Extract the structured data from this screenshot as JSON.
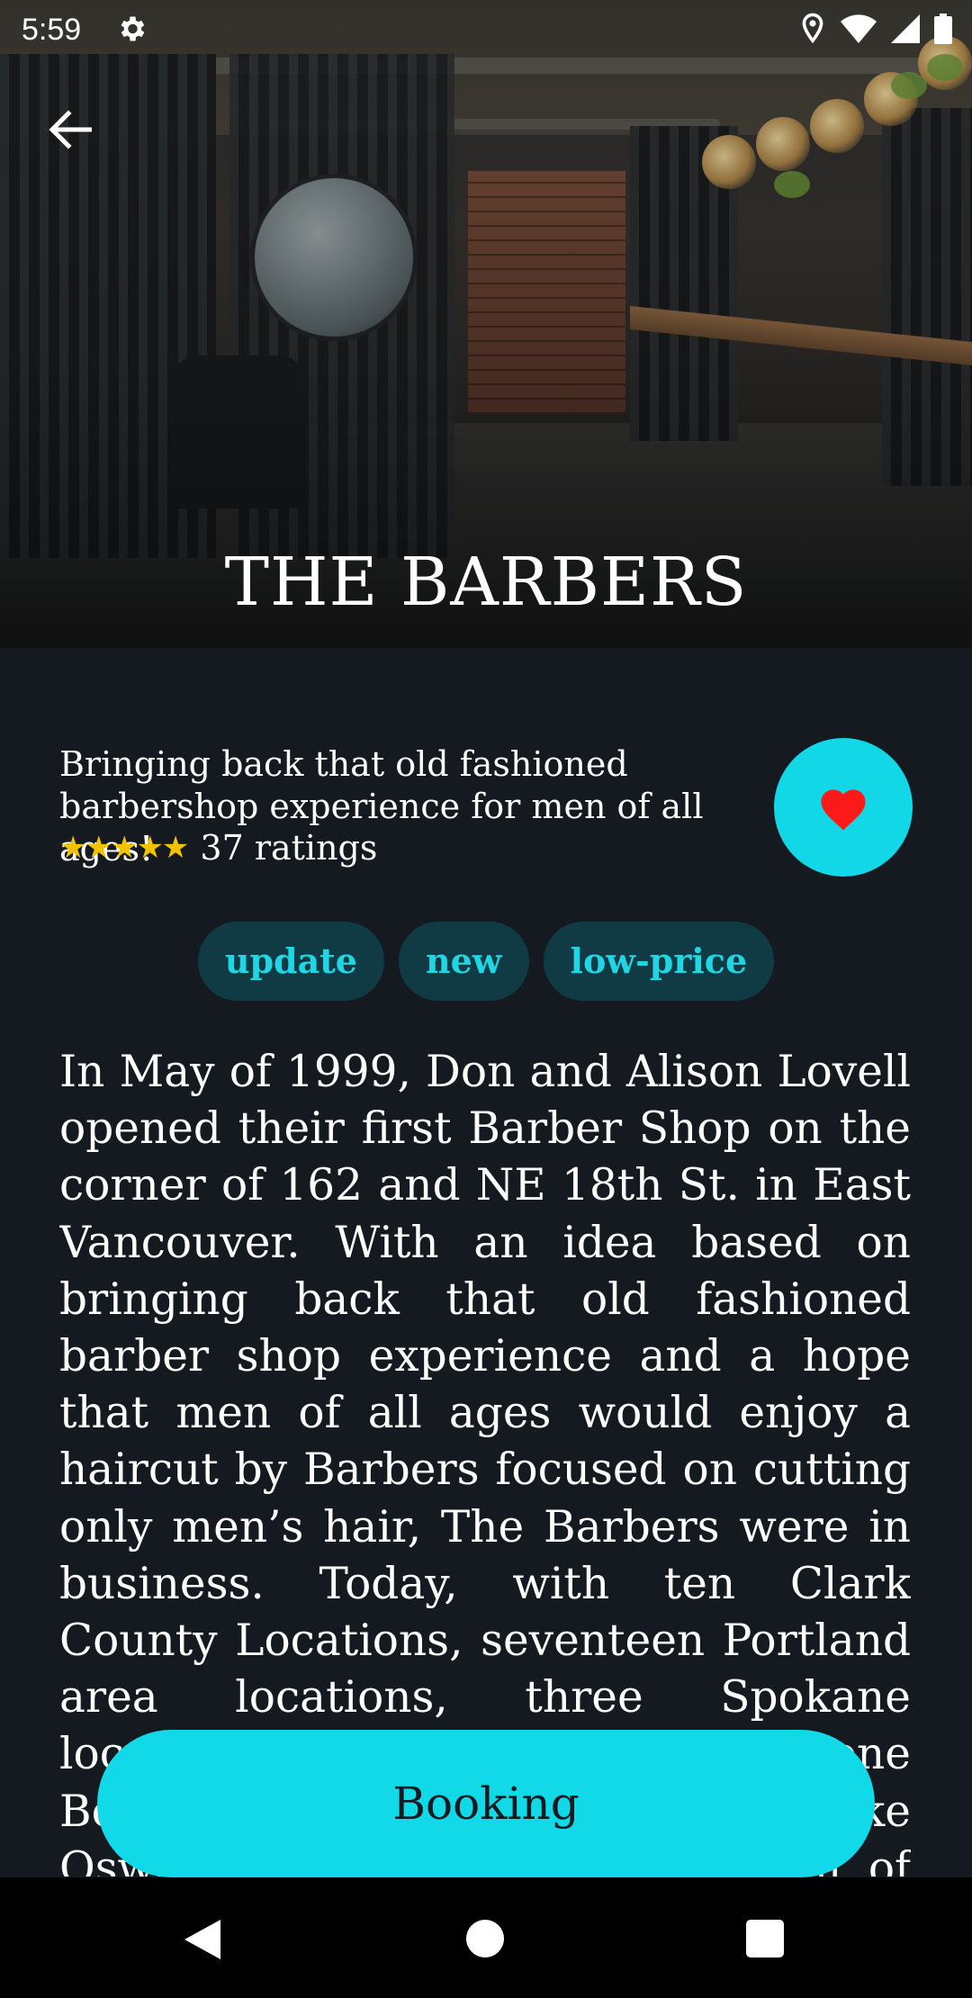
{
  "status_bar": {
    "time": "5:59",
    "icons": [
      "settings-icon",
      "location-icon",
      "wifi-icon",
      "signal-icon",
      "battery-icon"
    ]
  },
  "hero": {
    "title": "THE BARBERS",
    "image": "barbershop-interior-photo"
  },
  "shop": {
    "tagline": "Bringing back that old fashioned barbershop experience for men of all ages!",
    "stars": "★★★★★",
    "rating_value": 5,
    "ratings_count_text": "37 ratings",
    "favorite": true
  },
  "tags": [
    "update",
    "new",
    "low-price"
  ],
  "description": "In May of 1999, Don and Alison Lovell opened their first Barber Shop on the corner of 162 and NE 18th St. in East Vancouver. With an idea based on bringing back that old fashioned barber shop experience and a hope that men of all ages would enjoy a haircut by Barbers focused on cutting only men’s hair, The Barbers were in business. Today, with ten Clark County Locations, seventeen Portland area locations, three Spokane locations, one Corvallis location, one Bend location, one location in Lake Oswego and a growing the team of barbers and stylists a",
  "booking": {
    "label": "Booking"
  },
  "colors": {
    "background": "#141a20",
    "accent": "#12d7e6",
    "chip_bg": "#103b44",
    "chip_text": "#1fd6e4",
    "star": "#f2c200",
    "heart": "#ff1a1a"
  }
}
